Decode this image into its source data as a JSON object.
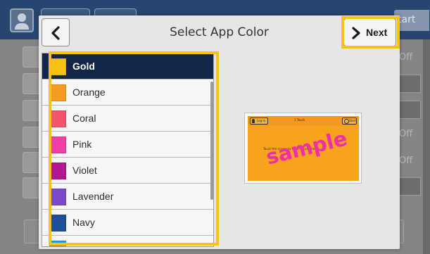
{
  "dialog": {
    "title": "Select App Color",
    "back_icon": "chevron-left-icon",
    "next_label": "Next",
    "next_icon": "chevron-right-icon"
  },
  "background": {
    "start_label": "tart",
    "right_labels": [
      "Off",
      "Off",
      "Off"
    ]
  },
  "colors": {
    "selected": "Gold",
    "items": [
      {
        "label": "Gold",
        "swatch": "#f6c313"
      },
      {
        "label": "Orange",
        "swatch": "#f59a22"
      },
      {
        "label": "Coral",
        "swatch": "#f2566b"
      },
      {
        "label": "Pink",
        "swatch": "#ef3fa4"
      },
      {
        "label": "Violet",
        "swatch": "#b3178f"
      },
      {
        "label": "Lavender",
        "swatch": "#7d4ac7"
      },
      {
        "label": "Navy",
        "swatch": "#1d4f9b"
      },
      {
        "label": "",
        "swatch": "#1fa0e3"
      }
    ]
  },
  "preview": {
    "watermark": "sample",
    "login_label": "Log In",
    "title": "1 Touch",
    "start_label": "Start",
    "message": "Touch the screen to begin Touch Start.",
    "header_color": "#f39a1e",
    "body_color": "#f7a31e"
  },
  "accent_colors": {
    "highlight": "#f6c313",
    "selected_row": "#12264a"
  }
}
